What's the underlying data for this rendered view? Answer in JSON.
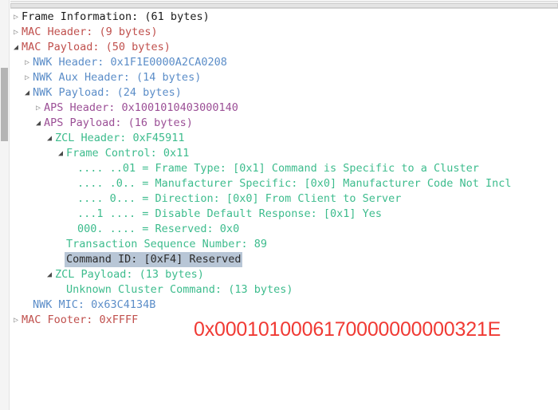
{
  "window": {
    "title": "Packet Detail Tree"
  },
  "scrollbars": {
    "horizontal_present": true,
    "vertical_present": true
  },
  "colors": {
    "frame_info": "#1a1a1a",
    "mac": "#c0504d",
    "nwk": "#5b8dc8",
    "aps": "#9b4f96",
    "zcl": "#3dbc8d",
    "selection_background": "#b8c6d6",
    "annotation": "#f03a34"
  },
  "icons": {
    "collapsed": "▷",
    "expanded": "◢"
  },
  "tree": {
    "rows": [
      {
        "depth": 0,
        "state": "collapsed",
        "color": "c-black",
        "text": "Frame Information: (61 bytes)",
        "selected": false
      },
      {
        "depth": 0,
        "state": "collapsed",
        "color": "c-mac",
        "text": "MAC Header: (9 bytes)",
        "selected": false
      },
      {
        "depth": 0,
        "state": "expanded",
        "color": "c-mac",
        "text": "MAC Payload: (50 bytes)",
        "selected": false
      },
      {
        "depth": 1,
        "state": "collapsed",
        "color": "c-nwk",
        "text": "NWK Header: 0x1F1E0000A2CA0208",
        "selected": false
      },
      {
        "depth": 1,
        "state": "collapsed",
        "color": "c-nwk",
        "text": "NWK Aux Header: (14 bytes)",
        "selected": false
      },
      {
        "depth": 1,
        "state": "expanded",
        "color": "c-nwk",
        "text": "NWK Payload: (24 bytes)",
        "selected": false
      },
      {
        "depth": 2,
        "state": "collapsed",
        "color": "c-aps",
        "text": "APS Header: 0x1001010403000140",
        "selected": false
      },
      {
        "depth": 2,
        "state": "expanded",
        "color": "c-aps",
        "text": "APS Payload: (16 bytes)",
        "selected": false
      },
      {
        "depth": 3,
        "state": "expanded",
        "color": "c-zcl",
        "text": "ZCL Header: 0xF45911",
        "selected": false
      },
      {
        "depth": 4,
        "state": "expanded",
        "color": "c-zcl",
        "text": "Frame Control: 0x11",
        "selected": false
      },
      {
        "depth": 5,
        "state": "none",
        "color": "c-zcl",
        "text": ".... ..01 = Frame Type: [0x1] Command is Specific to a Cluster",
        "selected": false
      },
      {
        "depth": 5,
        "state": "none",
        "color": "c-zcl",
        "text": ".... .0.. = Manufacturer Specific: [0x0] Manufacturer Code Not Incl",
        "selected": false
      },
      {
        "depth": 5,
        "state": "none",
        "color": "c-zcl",
        "text": ".... 0... = Direction: [0x0] From Client to Server",
        "selected": false
      },
      {
        "depth": 5,
        "state": "none",
        "color": "c-zcl",
        "text": "...1 .... = Disable Default Response: [0x1] Yes",
        "selected": false
      },
      {
        "depth": 5,
        "state": "none",
        "color": "c-zcl",
        "text": "000. .... = Reserved: 0x0",
        "selected": false
      },
      {
        "depth": 4,
        "state": "none",
        "color": "c-zcl",
        "text": "Transaction Sequence Number: 89",
        "selected": false
      },
      {
        "depth": 4,
        "state": "none",
        "color": "c-zcl",
        "text": "Command ID: [0xF4] Reserved",
        "selected": true
      },
      {
        "depth": 3,
        "state": "expanded",
        "color": "c-zcl",
        "text": "ZCL Payload: (13 bytes)",
        "selected": false
      },
      {
        "depth": 4,
        "state": "none",
        "color": "c-zcl",
        "text": "Unknown Cluster Command: (13 bytes)",
        "selected": false
      },
      {
        "depth": 1,
        "state": "none",
        "color": "c-nwk",
        "text": "NWK MIC: 0x63C4134B",
        "selected": false
      },
      {
        "depth": 0,
        "state": "collapsed",
        "color": "c-mac",
        "text": "MAC Footer: 0xFFFF",
        "selected": false
      }
    ]
  },
  "annotation": {
    "text": "0x0001010006170000000000321E"
  }
}
